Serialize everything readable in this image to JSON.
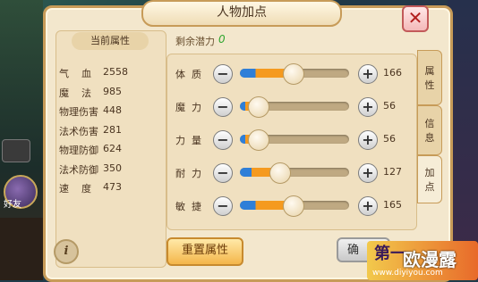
{
  "window": {
    "title": "人物加点",
    "close_symbol": "✕"
  },
  "stats": {
    "header": "当前属性",
    "rows": [
      {
        "label": "气    血",
        "value": "2558"
      },
      {
        "label": "魔    法",
        "value": "985"
      },
      {
        "label": "物理伤害",
        "value": "448"
      },
      {
        "label": "法术伤害",
        "value": "281"
      },
      {
        "label": "物理防御",
        "value": "624"
      },
      {
        "label": "法术防御",
        "value": "350"
      },
      {
        "label": "速    度",
        "value": "473"
      }
    ],
    "info_symbol": "i"
  },
  "potential": {
    "label": "剩余潜力",
    "value": "0"
  },
  "attributes": [
    {
      "name": "体  质",
      "value": "166",
      "fill_pct": 0.48
    },
    {
      "name": "魔  力",
      "value": "56",
      "fill_pct": 0.16
    },
    {
      "name": "力  量",
      "value": "56",
      "fill_pct": 0.16
    },
    {
      "name": "耐  力",
      "value": "127",
      "fill_pct": 0.36
    },
    {
      "name": "敏  捷",
      "value": "165",
      "fill_pct": 0.48
    }
  ],
  "controls": {
    "minus_symbol": "−",
    "plus_symbol": "+"
  },
  "buttons": {
    "reset": "重置属性",
    "confirm": "确"
  },
  "tabs": [
    {
      "label": "属\n性"
    },
    {
      "label": "信\n息"
    },
    {
      "label": "加\n点"
    }
  ],
  "side": {
    "friend": "好友"
  },
  "watermark": {
    "brand": "第一",
    "site_title": "欧漫露",
    "url": "www.diyiyou.com"
  },
  "colors": {
    "accent": "#f59a1f",
    "fill_blue": "#2f7fd8",
    "potential": "#2ea52e"
  }
}
